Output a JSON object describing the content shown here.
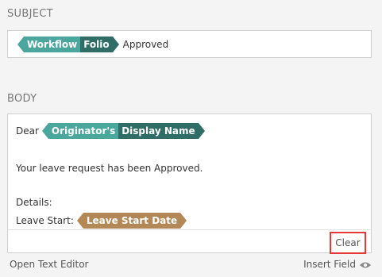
{
  "subject": {
    "label": "SUBJECT",
    "token": {
      "part1": "Workflow",
      "part2": "Folio"
    },
    "text": "Approved"
  },
  "body": {
    "label": "BODY",
    "greeting": "Dear",
    "token_originator": {
      "part1": "Originator's",
      "part2": "Display Name"
    },
    "line1": "Your leave request has been Approved.",
    "details_label": "Details:",
    "leave_start_label": "Leave Start:",
    "token_leave_start": {
      "part1": "Leave Start Date"
    },
    "clear_label": "Clear"
  },
  "footer": {
    "open_editor_label": "Open Text Editor",
    "insert_field_label": "Insert Field",
    "insert_field_icon": "eye-icon"
  },
  "colors": {
    "token_teal_light": "#4ba79e",
    "token_teal_dark": "#2f6d66",
    "token_brown": "#b28856",
    "highlight_border": "#e53935"
  }
}
